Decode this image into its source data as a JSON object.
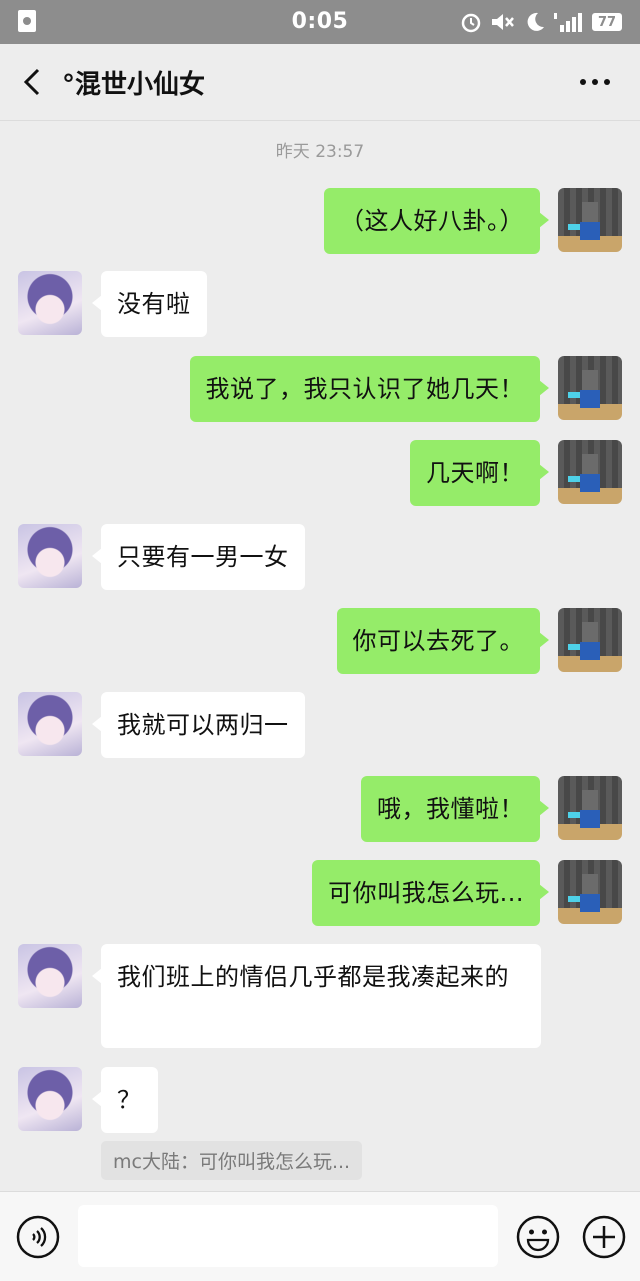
{
  "status_bar": {
    "time": "0:05",
    "battery": "77",
    "icons": [
      "sim-card-icon",
      "alarm-icon",
      "mute-icon",
      "moon-icon",
      "signal-icon",
      "battery-icon"
    ]
  },
  "header": {
    "title": "°混世小仙女",
    "back_icon": "chevron-left-icon",
    "more_icon": "more-dots-icon"
  },
  "chat": {
    "timestamp": "昨天 23:57",
    "messages": [
      {
        "sender": "me",
        "text": "（这人好八卦。）"
      },
      {
        "sender": "other",
        "text": "没有啦"
      },
      {
        "sender": "me",
        "text": "我说了，我只认识了她几天！"
      },
      {
        "sender": "me",
        "text": "几天啊！"
      },
      {
        "sender": "other",
        "text": "只要有一男一女"
      },
      {
        "sender": "me",
        "text": "你可以去死了。"
      },
      {
        "sender": "other",
        "text": "我就可以两归一"
      },
      {
        "sender": "me",
        "text": "哦，我懂啦！"
      },
      {
        "sender": "me",
        "text": "可你叫我怎么玩..."
      },
      {
        "sender": "other",
        "text": "我们班上的情侣几乎都是我凑起来的"
      },
      {
        "sender": "other",
        "text": "？"
      }
    ],
    "quote": "mc大陆：可你叫我怎么玩..."
  },
  "input_bar": {
    "placeholder": "",
    "icons": [
      "voice-icon",
      "emoji-icon",
      "plus-icon"
    ]
  },
  "colors": {
    "my_bubble": "#95ec69",
    "other_bubble": "#ffffff",
    "background": "#ededed",
    "status_bar": "#8d8d8d"
  }
}
